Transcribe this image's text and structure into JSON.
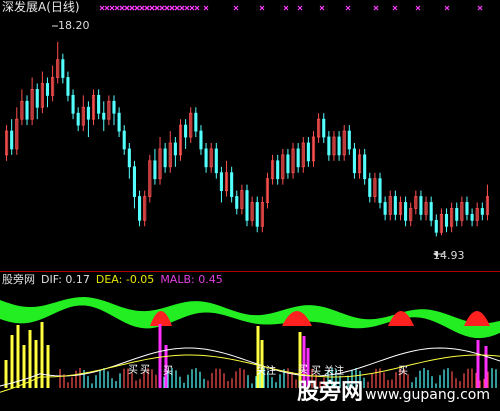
{
  "window": {
    "title": "深发展A(日线)"
  },
  "annotations": {
    "high": "18.20",
    "low": "14.93"
  },
  "indicator": {
    "name": "股旁网",
    "dif": "DIF: 0.17",
    "dea": "DEA: -0.05",
    "malb": "MALB: 0.45"
  },
  "event_labels": [
    "买",
    "买",
    "买",
    "关注",
    "买",
    "买",
    "关注",
    "买"
  ],
  "watermark": {
    "main": "股旁网",
    "url": "www.gupang.com"
  },
  "colors": {
    "up": "#ff5050",
    "down": "#54ffff",
    "background": "#000000",
    "marker": "#ff40ff",
    "green": "#22ee22",
    "red": "#ff2020",
    "yellow": "#ffff40",
    "magenta": "#ff30ff",
    "white": "#ffffff"
  },
  "chart_data": {
    "type": "candlestick",
    "price_high": 18.2,
    "price_low": 14.93,
    "ylim": [
      14.5,
      18.6
    ],
    "candles": [
      [
        16.3,
        16.7,
        16.2,
        16.8
      ],
      [
        16.7,
        16.4,
        16.3,
        16.9
      ],
      [
        16.4,
        16.9,
        16.3,
        17.1
      ],
      [
        16.9,
        17.2,
        16.8,
        17.4
      ],
      [
        17.2,
        16.9,
        16.8,
        17.3
      ],
      [
        16.9,
        17.4,
        16.8,
        17.6
      ],
      [
        17.4,
        17.1,
        16.9,
        17.5
      ],
      [
        17.1,
        17.5,
        17.0,
        17.7
      ],
      [
        17.5,
        17.3,
        17.1,
        17.6
      ],
      [
        17.3,
        17.6,
        17.2,
        17.8
      ],
      [
        17.6,
        17.9,
        17.5,
        18.2
      ],
      [
        17.9,
        17.6,
        17.5,
        18.0
      ],
      [
        17.6,
        17.3,
        17.2,
        17.7
      ],
      [
        17.3,
        17.0,
        16.9,
        17.4
      ],
      [
        17.0,
        16.8,
        16.7,
        17.1
      ],
      [
        16.8,
        17.1,
        16.7,
        17.3
      ],
      [
        17.1,
        16.9,
        16.6,
        17.2
      ],
      [
        16.9,
        17.3,
        16.8,
        17.4
      ],
      [
        17.3,
        17.0,
        16.9,
        17.4
      ],
      [
        17.0,
        16.9,
        16.7,
        17.2
      ],
      [
        16.9,
        17.2,
        16.8,
        17.3
      ],
      [
        17.2,
        17.0,
        16.8,
        17.3
      ],
      [
        17.0,
        16.7,
        16.6,
        17.1
      ],
      [
        16.7,
        16.4,
        16.3,
        16.8
      ],
      [
        16.4,
        16.1,
        15.9,
        16.5
      ],
      [
        16.1,
        15.6,
        15.4,
        16.2
      ],
      [
        15.6,
        15.2,
        15.1,
        15.7
      ],
      [
        15.2,
        15.6,
        15.1,
        15.7
      ],
      [
        15.6,
        16.2,
        15.5,
        16.3
      ],
      [
        16.2,
        15.9,
        15.8,
        16.4
      ],
      [
        15.9,
        16.4,
        15.8,
        16.6
      ],
      [
        16.4,
        16.1,
        16.0,
        16.5
      ],
      [
        16.1,
        16.5,
        16.0,
        16.7
      ],
      [
        16.5,
        16.3,
        16.1,
        16.6
      ],
      [
        16.3,
        16.8,
        16.2,
        16.9
      ],
      [
        16.8,
        16.6,
        16.4,
        16.9
      ],
      [
        16.6,
        17.0,
        16.5,
        17.1
      ],
      [
        17.0,
        16.7,
        16.6,
        17.1
      ],
      [
        16.7,
        16.4,
        16.3,
        16.8
      ],
      [
        16.4,
        16.1,
        16.0,
        16.5
      ],
      [
        16.1,
        16.4,
        16.0,
        16.5
      ],
      [
        16.4,
        16.0,
        15.9,
        16.5
      ],
      [
        16.0,
        15.7,
        15.5,
        16.1
      ],
      [
        15.7,
        16.0,
        15.6,
        16.2
      ],
      [
        16.0,
        15.6,
        15.5,
        16.1
      ],
      [
        15.6,
        15.4,
        15.3,
        15.7
      ],
      [
        15.4,
        15.7,
        15.3,
        15.8
      ],
      [
        15.7,
        15.2,
        15.1,
        15.8
      ],
      [
        15.2,
        15.5,
        15.1,
        15.6
      ],
      [
        15.5,
        15.1,
        15.0,
        15.6
      ],
      [
        15.1,
        15.5,
        15.0,
        15.6
      ],
      [
        15.5,
        15.9,
        15.4,
        16.0
      ],
      [
        15.9,
        16.2,
        15.8,
        16.3
      ],
      [
        16.2,
        15.9,
        15.8,
        16.3
      ],
      [
        15.9,
        16.3,
        15.8,
        16.4
      ],
      [
        16.3,
        16.0,
        15.9,
        16.4
      ],
      [
        16.0,
        16.4,
        15.9,
        16.5
      ],
      [
        16.4,
        16.1,
        16.0,
        16.5
      ],
      [
        16.1,
        16.5,
        16.0,
        16.6
      ],
      [
        16.5,
        16.2,
        16.1,
        16.6
      ],
      [
        16.2,
        16.6,
        16.1,
        16.7
      ],
      [
        16.6,
        16.9,
        16.5,
        17.0
      ],
      [
        16.9,
        16.6,
        16.5,
        17.0
      ],
      [
        16.6,
        16.3,
        16.2,
        16.7
      ],
      [
        16.3,
        16.6,
        16.2,
        16.7
      ],
      [
        16.6,
        16.3,
        16.2,
        16.7
      ],
      [
        16.3,
        16.7,
        16.2,
        16.8
      ],
      [
        16.7,
        16.4,
        16.3,
        16.8
      ],
      [
        16.4,
        16.0,
        15.9,
        16.5
      ],
      [
        16.0,
        16.3,
        15.9,
        16.4
      ],
      [
        16.3,
        15.9,
        15.8,
        16.4
      ],
      [
        15.9,
        15.6,
        15.5,
        16.0
      ],
      [
        15.6,
        15.9,
        15.5,
        16.0
      ],
      [
        15.9,
        15.5,
        15.4,
        16.0
      ],
      [
        15.5,
        15.3,
        15.2,
        15.6
      ],
      [
        15.3,
        15.6,
        15.2,
        15.7
      ],
      [
        15.6,
        15.3,
        15.2,
        15.7
      ],
      [
        15.3,
        15.5,
        15.2,
        15.6
      ],
      [
        15.5,
        15.2,
        15.1,
        15.6
      ],
      [
        15.2,
        15.4,
        15.1,
        15.5
      ],
      [
        15.4,
        15.6,
        15.3,
        15.7
      ],
      [
        15.6,
        15.3,
        15.2,
        15.7
      ],
      [
        15.3,
        15.5,
        15.2,
        15.6
      ],
      [
        15.5,
        15.2,
        15.1,
        15.6
      ],
      [
        15.2,
        15.0,
        14.93,
        15.3
      ],
      [
        15.0,
        15.3,
        14.95,
        15.4
      ],
      [
        15.3,
        15.1,
        15.0,
        15.4
      ],
      [
        15.1,
        15.4,
        15.0,
        15.5
      ],
      [
        15.4,
        15.2,
        15.1,
        15.5
      ],
      [
        15.2,
        15.5,
        15.1,
        15.6
      ],
      [
        15.5,
        15.3,
        15.2,
        15.6
      ],
      [
        15.3,
        15.2,
        15.1,
        15.4
      ],
      [
        15.2,
        15.4,
        15.1,
        15.5
      ],
      [
        15.4,
        15.3,
        15.2,
        15.5
      ],
      [
        15.3,
        15.6,
        15.2,
        15.8
      ]
    ]
  }
}
